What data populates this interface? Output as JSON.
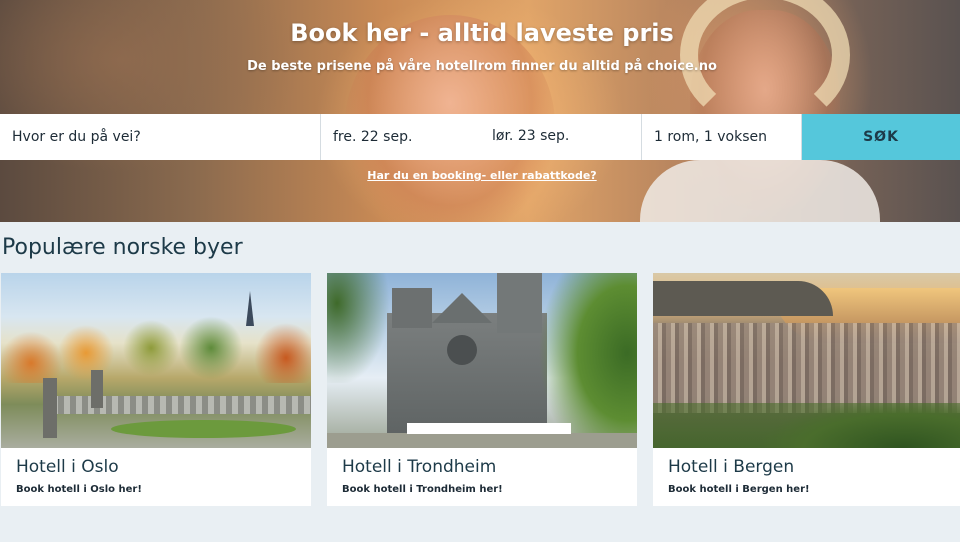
{
  "hero": {
    "title": "Book her - alltid laveste pris",
    "subtitle": "De beste prisene på våre hotellrom finner du alltid på choice.no"
  },
  "search": {
    "destination_placeholder": "Hvor er du på vei?",
    "checkin": "fre. 22 sep.",
    "checkout": "lør. 23 sep.",
    "rooms": "1 rom, 1 voksen",
    "search_button": "SØK",
    "booking_link": "Har du en booking- eller rabattkode?"
  },
  "popular": {
    "title": "Populære norske byer",
    "cards": [
      {
        "title": "Hotell i Oslo",
        "link": "Book hotell i Oslo her!"
      },
      {
        "title": "Hotell i Trondheim",
        "link": "Book hotell i Trondheim her!"
      },
      {
        "title": "Hotell i Bergen",
        "link": "Book hotell i Bergen her!"
      }
    ]
  },
  "colors": {
    "accent": "#55c7db",
    "text_dark": "#1d3a48",
    "page_bg": "#e9eff3"
  }
}
